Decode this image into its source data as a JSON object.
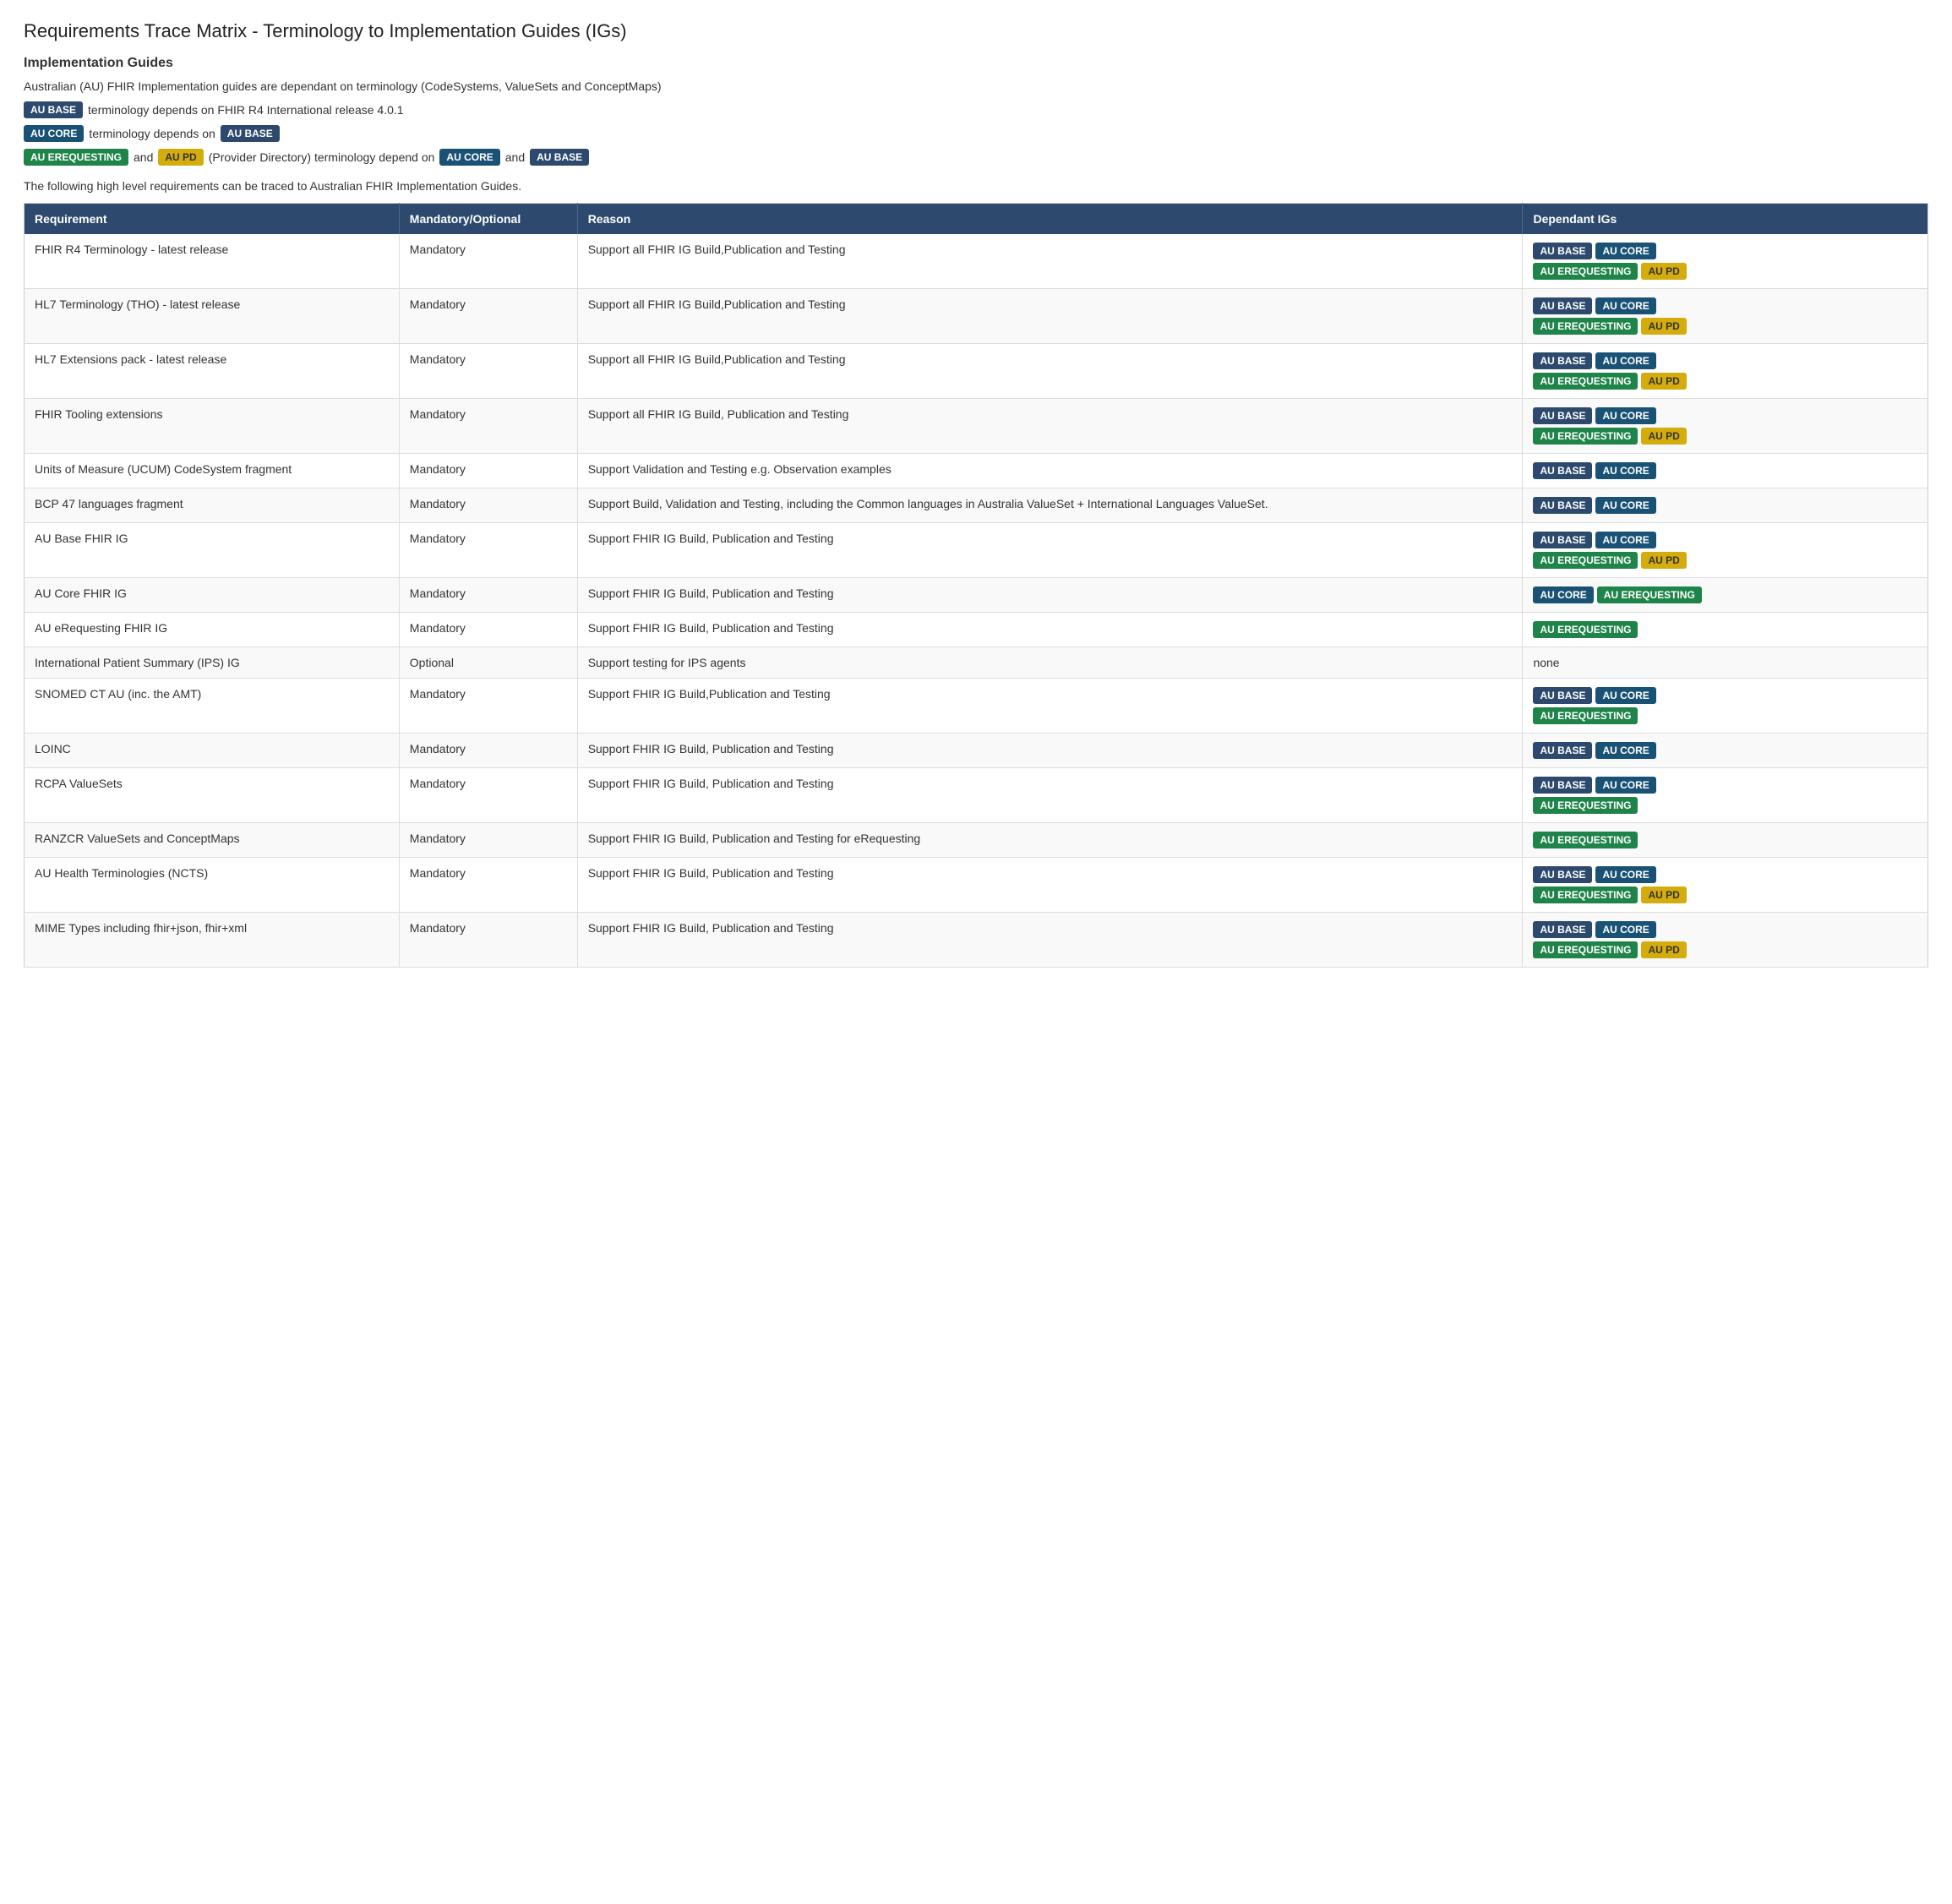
{
  "page": {
    "title": "Requirements Trace Matrix - Terminology to Implementation Guides (IGs)",
    "section_title": "Implementation Guides",
    "intro": "Australian (AU) FHIR Implementation guides are dependant on terminology (CodeSystems, ValueSets and ConceptMaps)",
    "line1_text": " terminology depends on FHIR R4 International release 4.0.1",
    "line2_pre": " terminology  depends on ",
    "line3_pre": " and ",
    "line3_mid": " (Provider Directory) terminology depend on ",
    "line3_and": " and ",
    "description": "The following high level requirements can be traced to Australian FHIR Implementation Guides.",
    "table": {
      "headers": [
        "Requirement",
        "Mandatory/Optional",
        "Reason",
        "Dependant IGs"
      ],
      "rows": [
        {
          "requirement": "FHIR R4 Terminology - latest release",
          "mandatory": "Mandatory",
          "reason": "Support all FHIR IG Build,Publication and Testing",
          "igs": [
            [
              "base",
              "core"
            ],
            [
              "erequesting",
              "pd"
            ]
          ]
        },
        {
          "requirement": "HL7 Terminology (THO) - latest release",
          "mandatory": "Mandatory",
          "reason": "Support all FHIR IG Build,Publication and Testing",
          "igs": [
            [
              "base",
              "core"
            ],
            [
              "erequesting",
              "pd"
            ]
          ]
        },
        {
          "requirement": "HL7 Extensions pack - latest release",
          "mandatory": "Mandatory",
          "reason": "Support all FHIR IG Build,Publication and Testing",
          "igs": [
            [
              "base",
              "core"
            ],
            [
              "erequesting",
              "pd"
            ]
          ]
        },
        {
          "requirement": "FHIR Tooling extensions",
          "mandatory": "Mandatory",
          "reason": "Support all FHIR IG Build, Publication and Testing",
          "igs": [
            [
              "base",
              "core"
            ],
            [
              "erequesting",
              "pd"
            ]
          ]
        },
        {
          "requirement": "Units of Measure (UCUM) CodeSystem fragment",
          "mandatory": "Mandatory",
          "reason": "Support Validation and Testing e.g. Observation examples",
          "igs": [
            [
              "base",
              "core"
            ]
          ]
        },
        {
          "requirement": "BCP 47 languages fragment",
          "mandatory": "Mandatory",
          "reason": "Support Build, Validation and Testing, including the Common languages in Australia ValueSet + International Languages ValueSet.",
          "igs": [
            [
              "base",
              "core"
            ]
          ]
        },
        {
          "requirement": "AU Base FHIR IG",
          "mandatory": "Mandatory",
          "reason": "Support FHIR IG Build, Publication and Testing",
          "igs": [
            [
              "base",
              "core"
            ],
            [
              "erequesting",
              "pd"
            ]
          ]
        },
        {
          "requirement": "AU Core FHIR IG",
          "mandatory": "Mandatory",
          "reason": "Support  FHIR IG Build, Publication and Testing",
          "igs": [
            [
              "core",
              "erequesting"
            ]
          ]
        },
        {
          "requirement": "AU eRequesting FHIR IG",
          "mandatory": "Mandatory",
          "reason": "Support  FHIR IG Build, Publication and Testing",
          "igs": [
            [
              "erequesting"
            ]
          ]
        },
        {
          "requirement": "International Patient Summary (IPS) IG",
          "mandatory": "Optional",
          "reason": "Support testing for IPS agents",
          "igs": [
            [
              "none"
            ]
          ]
        },
        {
          "requirement": "SNOMED CT AU (inc. the AMT)",
          "mandatory": "Mandatory",
          "reason": "Support FHIR IG Build,Publication and Testing",
          "igs": [
            [
              "base",
              "core"
            ],
            [
              "erequesting"
            ]
          ]
        },
        {
          "requirement": "LOINC",
          "mandatory": "Mandatory",
          "reason": "Support FHIR IG Build, Publication and Testing",
          "igs": [
            [
              "base",
              "core"
            ]
          ]
        },
        {
          "requirement": "RCPA ValueSets",
          "mandatory": "Mandatory",
          "reason": "Support FHIR IG Build, Publication and Testing",
          "igs": [
            [
              "base",
              "core"
            ],
            [
              "erequesting"
            ]
          ]
        },
        {
          "requirement": "RANZCR ValueSets and ConceptMaps",
          "mandatory": "Mandatory",
          "reason": "Support FHIR IG Build, Publication and Testing for eRequesting",
          "igs": [
            [
              "erequesting"
            ]
          ]
        },
        {
          "requirement": "AU Health Terminologies (NCTS)",
          "mandatory": "Mandatory",
          "reason": "Support FHIR IG Build, Publication and Testing",
          "igs": [
            [
              "base",
              "core"
            ],
            [
              "erequesting",
              "pd"
            ]
          ]
        },
        {
          "requirement": "MIME Types including fhir+json, fhir+xml",
          "mandatory": "Mandatory",
          "reason": "Support FHIR IG Build, Publication and Testing",
          "igs": [
            [
              "base",
              "core"
            ],
            [
              "erequesting",
              "pd"
            ]
          ]
        }
      ]
    }
  }
}
